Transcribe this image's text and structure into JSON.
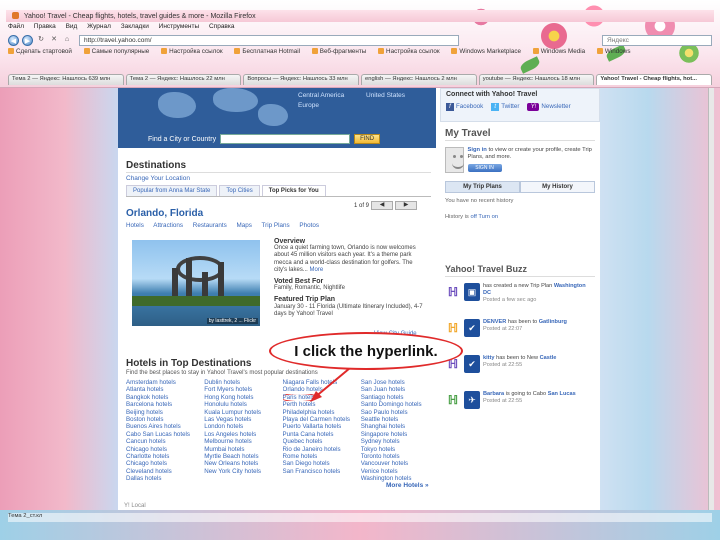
{
  "browser": {
    "title": "Yahoo! Travel - Cheap flights, hotels, travel guides & more - Mozilla Firefox",
    "menu": [
      "Файл",
      "Правка",
      "Вид",
      "Журнал",
      "Закладки",
      "Инструменты",
      "Справка"
    ],
    "url": "http://travel.yahoo.com/",
    "search_placeholder": "Яндекс",
    "bookmarks": [
      "Сделать стартовой",
      "Самые популярные",
      "Настройка ссылок",
      "Бесплатная Hotmail",
      "Веб-фрагменты",
      "Настройка ссылок",
      "Windows Marketplace",
      "Windows Media",
      "Windows"
    ],
    "tabs": [
      "Тема 2 — Яндекс: Нашлось 639 млн",
      "Тема 2 — Яндекс: Нашлось 22 млн",
      "Вопросы — Яндекс: Нашлось 33 млн",
      "english — Яндекс: Нашлось 2 млн",
      "youtube — Яндекс: Нашлось 18 млн",
      "Yahoo! Travel - Cheap flights, hot..."
    ],
    "active_tab_index": 5,
    "bottom_text": "Тема 2_ст.кл",
    "footer_text": "Y! Local"
  },
  "hero": {
    "region_links": [
      "Central America",
      "United States",
      "Europe"
    ],
    "find_label": "Find a City or Country",
    "find_button": "FIND"
  },
  "destinations": {
    "heading": "Destinations",
    "change_location": "Change Your Location",
    "tabs": [
      "Popular from Anna Mar State",
      "Top Cities",
      "Top Picks for You"
    ],
    "active_tab": 2,
    "city": "Orlando, Florida",
    "pager": "1 of 9",
    "city_links": [
      "Hotels",
      "Attractions",
      "Restaurants",
      "Maps",
      "Trip Plans",
      "Photos"
    ],
    "photo_credit": "by lasttrek, 2 ... Flickr",
    "overview_title": "Overview",
    "overview_text": "Once a quiet farming town, Orlando is now welcomes about 45 million visitors each year. It's a theme park mecca and a world-class destination for golfers. The city's lakes...",
    "overview_more": "More",
    "voted_title": "Voted Best For",
    "voted_text": "Family, Romantic, Nightlife",
    "trip_title": "Featured Trip Plan",
    "trip_text": "January 30 - 11 Florida (Ultimate Itinerary Included), 4-7 days by Yahoo! Travel",
    "view_city": "View City Guide"
  },
  "hotels": {
    "heading": "Hotels in Top Destinations",
    "subtitle": "Find the best places to stay in Yahoo! Travel's most popular destinations",
    "columns": [
      [
        "Amsterdam hotels",
        "Atlanta hotels",
        "Bangkok hotels",
        "Barcelona hotels",
        "Beijing hotels",
        "Boston hotels",
        "Buenos Aires hotels",
        "Cabo San Lucas hotels",
        "Cancun hotels",
        "Chicago hotels",
        "Charlotte hotels",
        "Chicago hotels",
        "Cleveland hotels",
        "Dallas hotels"
      ],
      [
        "Dublin hotels",
        "Fort Myers hotels",
        "Hong Kong hotels",
        "Honolulu hotels",
        "Kuala Lumpur hotels",
        "Las Vegas hotels",
        "London hotels",
        "Los Angeles hotels",
        "Melbourne hotels",
        "Mumbai hotels",
        "Myrtle Beach hotels",
        "New Orleans hotels",
        "New York City hotels"
      ],
      [
        "Niagara Falls hotels",
        "Orlando hotels",
        "Paris hotels",
        "Perth hotels",
        "Philadelphia hotels",
        "Playa del Carmen hotels",
        "Puerto Vallarta hotels",
        "Punta Cana hotels",
        "Quebec hotels",
        "Rio de Janeiro hotels",
        "Rome hotels",
        "San Diego hotels",
        "San Francisco hotels"
      ],
      [
        "San Jose hotels",
        "San Juan hotels",
        "Santiago hotels",
        "Santo Domingo hotels",
        "Sao Paulo hotels",
        "Seattle hotels",
        "Shanghai hotels",
        "Singapore hotels",
        "Sydney hotels",
        "Tokyo hotels",
        "Toronto hotels",
        "Vancouver hotels",
        "Venice hotels",
        "Washington hotels"
      ]
    ],
    "highlighted_link": "Paris hotels",
    "more_hotels": "More Hotels »"
  },
  "connect": {
    "title": "Connect with Yahoo! Travel",
    "facebook": "Facebook",
    "twitter": "Twitter",
    "newsletter": "Newsletter"
  },
  "my_travel": {
    "title": "My Travel",
    "signin_link": "Sign in",
    "signin_text": "to view or create your profile, create Trip Plans, and more.",
    "signin_button": "SIGN IN",
    "tabs": [
      "My Trip Plans",
      "My History"
    ],
    "active_tab": 1,
    "note": "You have no recent history",
    "history_prefix": "History is",
    "history_link": "off",
    "history_suffix": "Turn on"
  },
  "buzz": {
    "title": "Yahoo! Travel Buzz",
    "items": [
      {
        "icon": "briefcase-icon",
        "color": "#1e4f9c",
        "user": "",
        "action": "has created a new Trip Plan",
        "target": "Washington DC",
        "time": "Posted a few sec ago"
      },
      {
        "icon": "check-icon",
        "color": "#1e4f9c",
        "user": "DENVER",
        "action": "has been to",
        "target": "Gatlinburg",
        "time": "Posted at 22:07"
      },
      {
        "icon": "check-icon",
        "color": "#1e4f9c",
        "user": "kitty",
        "action": "has been to New",
        "target": "Castle",
        "time": "Posted at 22:55"
      },
      {
        "icon": "plane-icon",
        "color": "#1e4f9c",
        "user": "Barbara",
        "action": "is going to Cabo",
        "target": "San Lucas",
        "time": "Posted at 22:55"
      }
    ],
    "logo_colors": [
      "#6b4dbd",
      "#f1a72b",
      "#6b4dbd",
      "#4aa047"
    ]
  },
  "callout": {
    "text": "I click the hyperlink."
  },
  "colors": {
    "link": "#3867b8",
    "callout_border": "#e02a2a"
  }
}
